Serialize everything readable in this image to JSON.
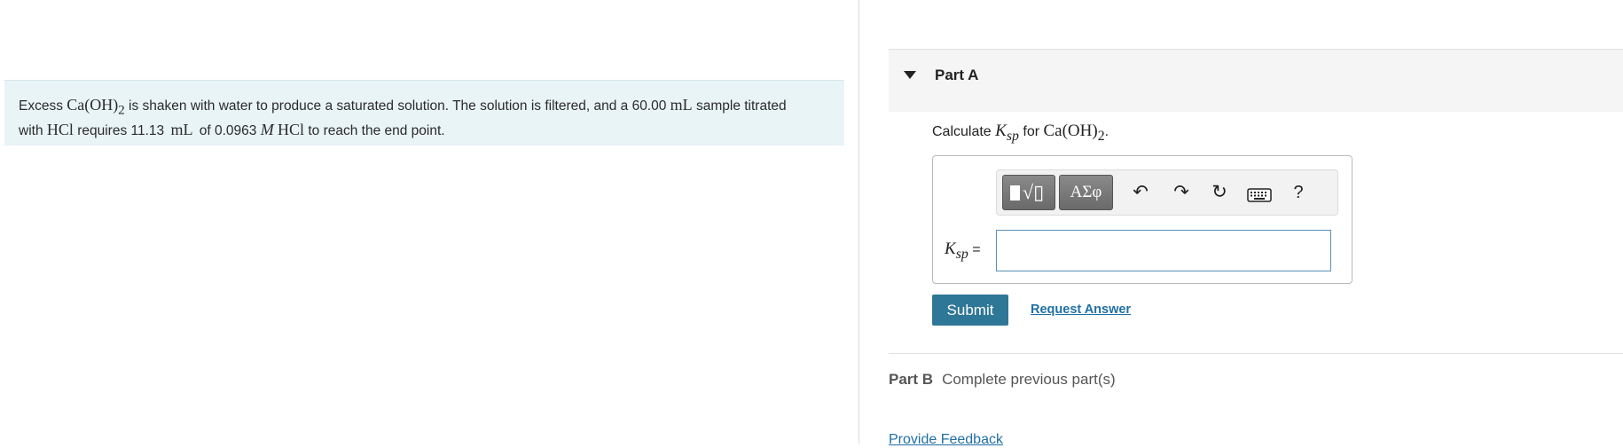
{
  "problem": {
    "t1": "Excess ",
    "compound": "Ca(OH)",
    "sub2": "2",
    "t2": " is shaken with water to produce a saturated solution. The solution is filtered, and a 60.00 ",
    "unit_ml": "mL",
    "t3": " sample titrated",
    "t4": "with ",
    "hcl": "HCl",
    "t5": " requires 11.13 ",
    "unit_ml2": "mL",
    "t6": " of 0.0963 ",
    "molar": "M",
    "hcl2": "HCl",
    "t7": " to reach the end point."
  },
  "partA": {
    "title": "Part A",
    "question_prefix": "Calculate ",
    "K": "K",
    "sp": "sp",
    "question_mid": " for ",
    "compound": "Ca(OH)",
    "sub2": "2",
    "question_end": ".",
    "toolbar": {
      "templates_icon": "√▯",
      "greek_label": "ΑΣφ",
      "undo_icon": "↶",
      "redo_icon": "↷",
      "reset_icon": "↻",
      "keyboard_icon": "keyboard-icon",
      "help_label": "?"
    },
    "input_label_eq": " =",
    "input_value": "",
    "submit_label": "Submit",
    "request_answer_label": "Request Answer"
  },
  "partB": {
    "label": "Part B",
    "status": "Complete previous part(s)"
  },
  "feedback_label": "Provide Feedback",
  "colors": {
    "problem_bg": "#e9f4f6",
    "submit_bg": "#2f7797",
    "link": "#1f6fa6"
  }
}
